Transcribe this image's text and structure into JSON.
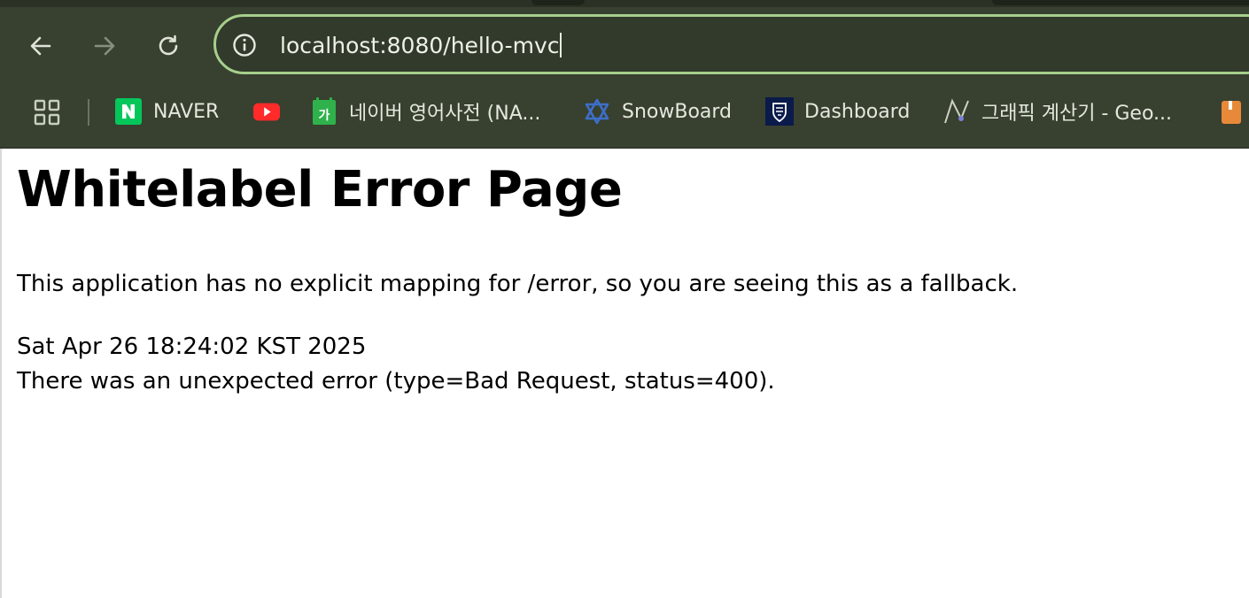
{
  "browser": {
    "url": "localhost:8080/hello-mvc",
    "colors": {
      "chrome_bg": "#38402f",
      "omnibox_border": "#a6cf8c",
      "omnibox_bg": "#323a2b",
      "text": "#e4e8de"
    },
    "nav": {
      "back_icon": "arrow-left-icon",
      "forward_icon": "arrow-right-icon",
      "reload_icon": "reload-icon",
      "site_info_icon": "info-icon"
    },
    "bookmarks": [
      {
        "label": "NAVER",
        "icon": "naver-icon",
        "icon_text": "N",
        "color": "#03c75a"
      },
      {
        "label": "",
        "icon": "youtube-icon",
        "color": "#ff2a2a"
      },
      {
        "label": "네이버 영어사전 (NA...",
        "icon": "naver-dictionary-icon",
        "icon_text": "가",
        "color": "#2fb14b"
      },
      {
        "label": "SnowBoard",
        "icon": "star-of-david-icon",
        "color": "#3d6fc9"
      },
      {
        "label": "Dashboard",
        "icon": "university-crest-icon",
        "color": "#0a1a4a"
      },
      {
        "label": "그래픽 계산기 - Geo...",
        "icon": "geogebra-icon",
        "color": "#7a7fd6"
      },
      {
        "label": "",
        "icon": "bookmark-folder-icon",
        "color": "#e8893a"
      }
    ]
  },
  "page": {
    "title": "Whitelabel Error Page",
    "description": "This application has no explicit mapping for /error, so you are seeing this as a fallback.",
    "timestamp": "Sat Apr 26 18:24:02 KST 2025",
    "detail": "There was an unexpected error (type=Bad Request, status=400)."
  }
}
